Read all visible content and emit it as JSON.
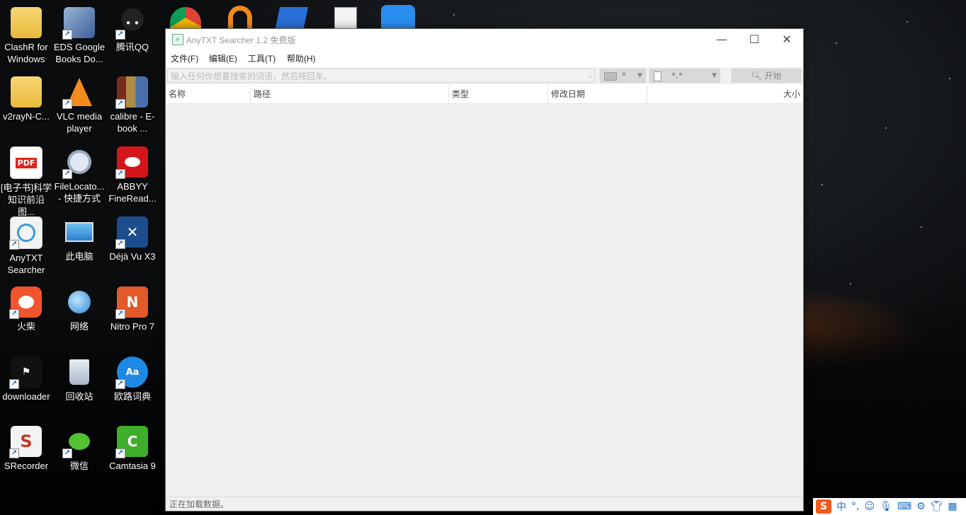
{
  "desktop": {
    "icons": [
      {
        "label": "ClashR for Windows",
        "icon": "folder-icon"
      },
      {
        "label": "EDS Google Books Do...",
        "icon": "book-download-icon"
      },
      {
        "label": "腾讯QQ",
        "icon": "qq-penguin-icon"
      },
      {
        "label": "v2rayN-C...",
        "icon": "folder-icon"
      },
      {
        "label": "VLC media player",
        "icon": "vlc-cone-icon"
      },
      {
        "label": "calibre - E-book ...",
        "icon": "calibre-books-icon"
      },
      {
        "label": "[电子书]科学知识前沿图...",
        "icon": "pdf-file-icon"
      },
      {
        "label": "FileLocato... - 快捷方式",
        "icon": "magnifier-icon"
      },
      {
        "label": "ABBYY FineRead...",
        "icon": "abbyy-icon"
      },
      {
        "label": "AnyTXT Searcher",
        "icon": "anytxt-icon"
      },
      {
        "label": "此电脑",
        "icon": "computer-icon"
      },
      {
        "label": "Déjà Vu X3",
        "icon": "dejavu-icon"
      },
      {
        "label": "火柴",
        "icon": "huochai-icon"
      },
      {
        "label": "网络",
        "icon": "network-globe-icon"
      },
      {
        "label": "Nitro Pro 7",
        "icon": "nitro-icon"
      },
      {
        "label": "downloader",
        "icon": "downloader-icon"
      },
      {
        "label": "回收站",
        "icon": "recycle-bin-icon"
      },
      {
        "label": "欧路词典",
        "icon": "eudic-icon"
      },
      {
        "label": "SRecorder",
        "icon": "srecorder-icon"
      },
      {
        "label": "微信",
        "icon": "wechat-icon"
      },
      {
        "label": "Camtasia 9",
        "icon": "camtasia-icon"
      }
    ]
  },
  "window": {
    "title": "AnyTXT Searcher 1.2 免费版",
    "controls": {
      "minimize": "—",
      "maximize": "☐",
      "close": "✕"
    },
    "menu": [
      "文件(F)",
      "编辑(E)",
      "工具(T)",
      "帮助(H)"
    ],
    "toolbar": {
      "search_placeholder": "输入任何你想要搜索的词语，然后按回车。",
      "drive_value": "*",
      "filetype_value": "*.*",
      "start_label": "开始"
    },
    "columns": [
      "名称",
      "路径",
      "类型",
      "修改日期",
      "大小"
    ],
    "status": "正在加载数据。"
  },
  "tray": {
    "ime_label": "中",
    "ime_punct": "°,"
  }
}
